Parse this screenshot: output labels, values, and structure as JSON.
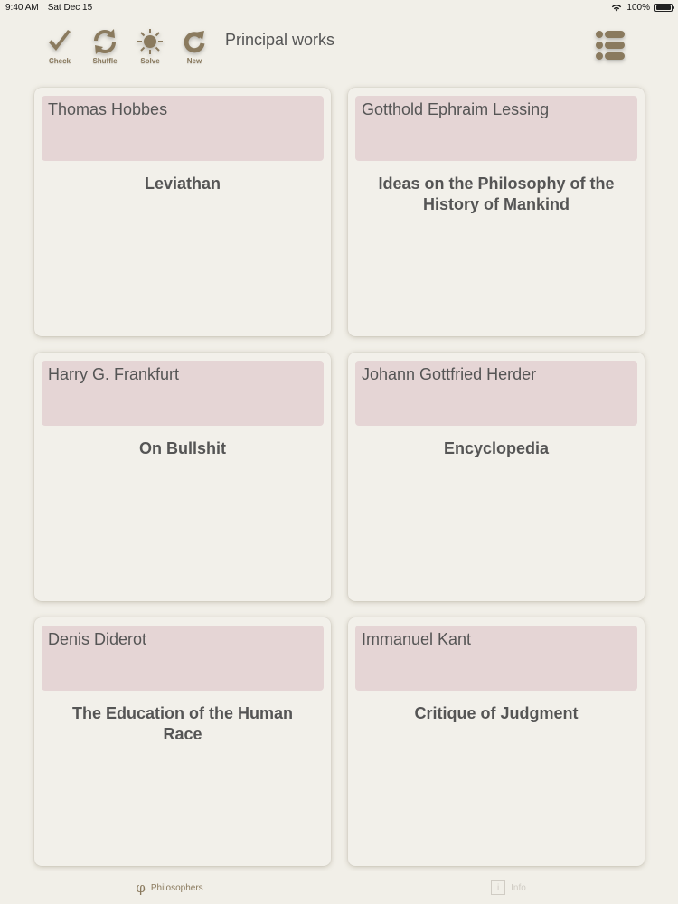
{
  "status": {
    "time": "9:40 AM",
    "date": "Sat Dec 15",
    "battery": "100%",
    "wifi_icon": "wifi-icon"
  },
  "toolbar": {
    "check_label": "Check",
    "shuffle_label": "Shuffle",
    "solve_label": "Solve",
    "new_label": "New",
    "title": "Principal works",
    "icon_color": "#8a7a5e"
  },
  "cards": [
    {
      "philosopher": "Thomas Hobbes",
      "work": "Leviathan"
    },
    {
      "philosopher": "Gotthold Ephraim Lessing",
      "work": "Ideas on the Philosophy of the History of Mankind"
    },
    {
      "philosopher": "Harry G. Frankfurt",
      "work": "On Bullshit"
    },
    {
      "philosopher": "Johann Gottfried Herder",
      "work": "Encyclopedia"
    },
    {
      "philosopher": "Denis Diderot",
      "work": "The Education of the Human Race"
    },
    {
      "philosopher": "Immanuel Kant",
      "work": "Critique of Judgment"
    }
  ],
  "tabs": {
    "philosophers_label": "Philosophers",
    "philosophers_icon": "φ",
    "info_label": "Info",
    "info_icon": "i"
  },
  "colors": {
    "background": "#f1efe8",
    "card_header": "#e5d5d5",
    "accent": "#8a7a5e"
  }
}
